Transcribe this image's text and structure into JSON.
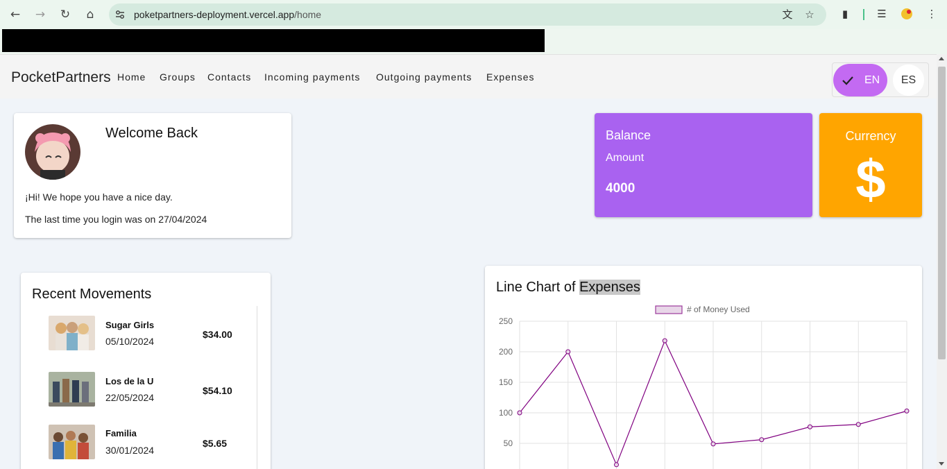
{
  "browser": {
    "url_host": "poketpartners-deployment.vercel.app",
    "url_path": "/home"
  },
  "header": {
    "brand": "PocketPartners",
    "nav": [
      "Home",
      "Groups",
      "Contacts",
      "Incoming payments",
      "Outgoing payments",
      "Expenses"
    ],
    "lang_active": "EN",
    "lang_other": "ES"
  },
  "welcome": {
    "title": "Welcome Back",
    "greeting": "¡Hi! We hope you have a nice day.",
    "last_login": "The last time you login was on 27/04/2024"
  },
  "balance": {
    "title": "Balance",
    "label": "Amount",
    "value": "4000"
  },
  "currency": {
    "title": "Currency",
    "symbol": "$"
  },
  "recent": {
    "title": "Recent Movements",
    "items": [
      {
        "name": "Sugar Girls",
        "date": "05/10/2024",
        "amount": "$34.00"
      },
      {
        "name": "Los de la U",
        "date": "22/05/2024",
        "amount": "$54.10"
      },
      {
        "name": "Familia",
        "date": "30/01/2024",
        "amount": "$5.65"
      }
    ]
  },
  "chart": {
    "title_prefix": "Line Chart of ",
    "title_highlight": "Expenses"
  },
  "chart_data": {
    "type": "line",
    "title": "Line Chart of Expenses",
    "series": [
      {
        "name": "# of Money Used",
        "values": [
          100,
          200,
          15,
          218,
          49,
          56,
          77,
          81,
          103
        ],
        "color": "#800080"
      }
    ],
    "y_ticks": [
      "250",
      "200",
      "150",
      "100",
      "50"
    ],
    "ylim": [
      0,
      250
    ],
    "grid": true,
    "legend": "top"
  }
}
